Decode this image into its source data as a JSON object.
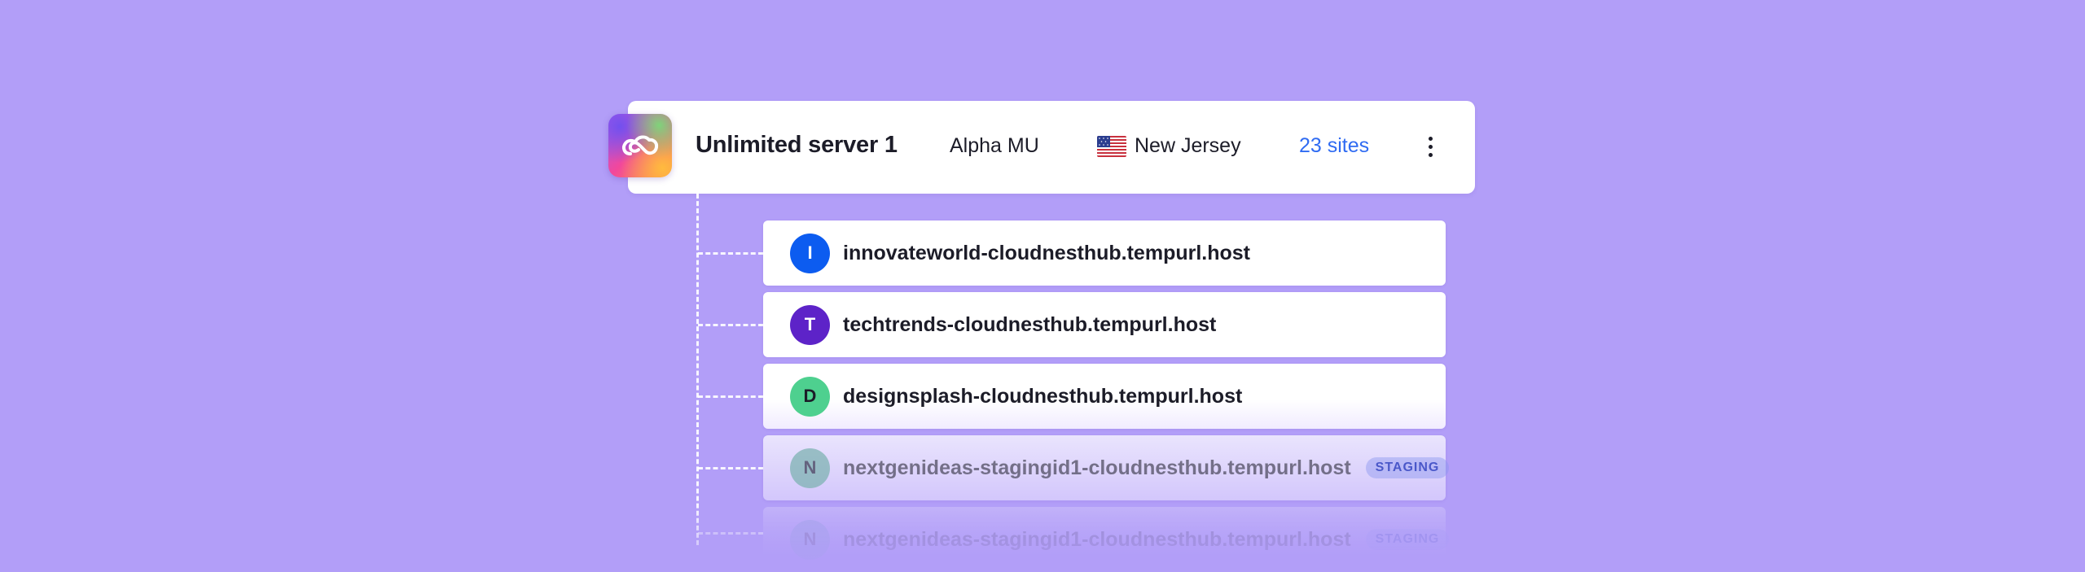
{
  "server": {
    "name": "Unlimited server 1",
    "plan": "Alpha MU",
    "location": "New Jersey",
    "location_flag_icon": "us-flag-icon",
    "sites_count": "23 sites",
    "logo_icon": "infinity-cloud-logo-icon",
    "menu_icon": "vertical-ellipsis-icon"
  },
  "sites": [
    {
      "initial": "I",
      "domain": "innovateworld-cloudnesthub.tempurl.host",
      "badge": "",
      "avatar_color": "#0c5cf0",
      "avatar_text_color": "#ffffff"
    },
    {
      "initial": "T",
      "domain": "techtrends-cloudnesthub.tempurl.host",
      "badge": "",
      "avatar_color": "#5d23c8",
      "avatar_text_color": "#ffffff"
    },
    {
      "initial": "D",
      "domain": "designsplash-cloudnesthub.tempurl.host",
      "badge": "",
      "avatar_color": "#4ed08f",
      "avatar_text_color": "#1c1c28"
    },
    {
      "initial": "N",
      "domain": "nextgenideas-stagingid1-cloudnesthub.tempurl.host",
      "badge": "STAGING",
      "avatar_color": "#7fb3b3",
      "avatar_text_color": "#3b3b55"
    },
    {
      "initial": "N",
      "domain": "nextgenideas-stagingid1-cloudnesthub.tempurl.host",
      "badge": "STAGING",
      "avatar_color": "#8fa8d8",
      "avatar_text_color": "#4a4a66"
    }
  ],
  "colors": {
    "background": "#b29ef8",
    "link": "#2f6bf2",
    "text": "#1c1c28",
    "badge_text": "#4a58c9"
  }
}
